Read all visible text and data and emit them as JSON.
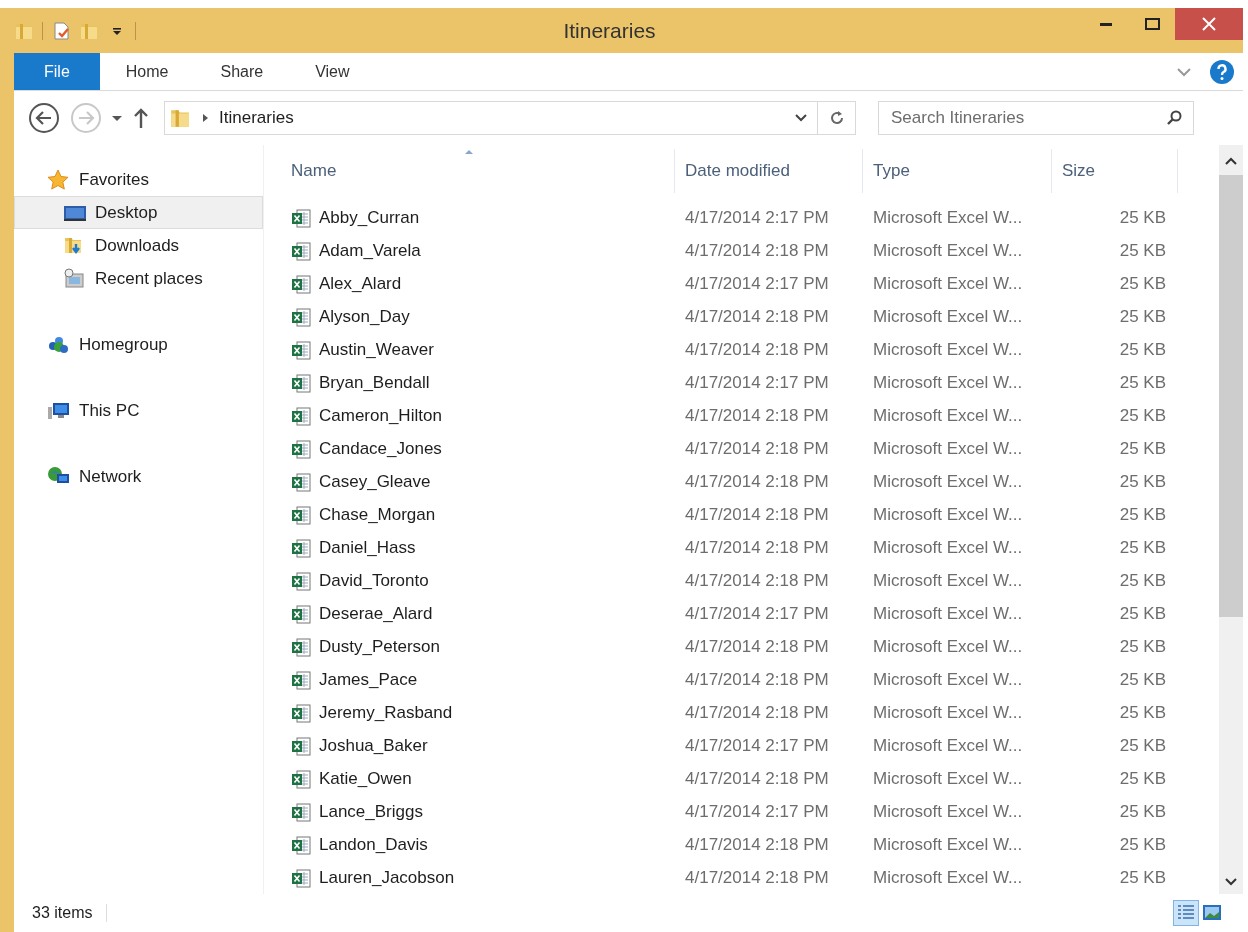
{
  "window": {
    "title": "Itineraries"
  },
  "quick_access": [
    {
      "kind": "folder"
    },
    {
      "kind": "properties"
    },
    {
      "kind": "new_folder"
    },
    {
      "kind": "customize"
    }
  ],
  "ribbon": {
    "tabs": [
      {
        "label": "File",
        "kind": "menu"
      },
      {
        "label": "Home",
        "kind": "tab"
      },
      {
        "label": "Share",
        "kind": "tab"
      },
      {
        "label": "View",
        "kind": "tab"
      }
    ]
  },
  "nav_buttons": [
    {
      "kind": "back",
      "disabled": false
    },
    {
      "kind": "forward",
      "disabled": true
    },
    {
      "kind": "recent",
      "disabled": false
    },
    {
      "kind": "up",
      "disabled": false
    }
  ],
  "address": {
    "crumbs": [
      "Itineraries"
    ]
  },
  "search": {
    "placeholder": "Search Itineraries"
  },
  "sidebar": {
    "items": [
      {
        "label": "Favorites",
        "kind": "favorites",
        "selected": false,
        "children": [
          {
            "label": "Desktop",
            "kind": "desktop",
            "selected": true
          },
          {
            "label": "Downloads",
            "kind": "downloads",
            "selected": false
          },
          {
            "label": "Recent places",
            "kind": "recent",
            "selected": false
          }
        ]
      },
      {
        "label": "Homegroup",
        "kind": "homegroup",
        "selected": false
      },
      {
        "label": "This PC",
        "kind": "pc",
        "selected": false
      },
      {
        "label": "Network",
        "kind": "network",
        "selected": false
      }
    ]
  },
  "table": {
    "columns": [
      {
        "label": "Name",
        "sorted": true
      },
      {
        "label": "Date modified",
        "sorted": false
      },
      {
        "label": "Type",
        "sorted": false
      },
      {
        "label": "Size",
        "sorted": false
      }
    ],
    "rows": [
      [
        "Abby_Curran",
        "4/17/2014 2:17 PM",
        "Microsoft Excel W...",
        "25 KB"
      ],
      [
        "Adam_Varela",
        "4/17/2014 2:18 PM",
        "Microsoft Excel W...",
        "25 KB"
      ],
      [
        "Alex_Alard",
        "4/17/2014 2:17 PM",
        "Microsoft Excel W...",
        "25 KB"
      ],
      [
        "Alyson_Day",
        "4/17/2014 2:18 PM",
        "Microsoft Excel W...",
        "25 KB"
      ],
      [
        "Austin_Weaver",
        "4/17/2014 2:18 PM",
        "Microsoft Excel W...",
        "25 KB"
      ],
      [
        "Bryan_Bendall",
        "4/17/2014 2:17 PM",
        "Microsoft Excel W...",
        "25 KB"
      ],
      [
        "Cameron_Hilton",
        "4/17/2014 2:18 PM",
        "Microsoft Excel W...",
        "25 KB"
      ],
      [
        "Candace_Jones",
        "4/17/2014 2:18 PM",
        "Microsoft Excel W...",
        "25 KB"
      ],
      [
        "Casey_Gleave",
        "4/17/2014 2:18 PM",
        "Microsoft Excel W...",
        "25 KB"
      ],
      [
        "Chase_Morgan",
        "4/17/2014 2:18 PM",
        "Microsoft Excel W...",
        "25 KB"
      ],
      [
        "Daniel_Hass",
        "4/17/2014 2:18 PM",
        "Microsoft Excel W...",
        "25 KB"
      ],
      [
        "David_Toronto",
        "4/17/2014 2:18 PM",
        "Microsoft Excel W...",
        "25 KB"
      ],
      [
        "Deserae_Alard",
        "4/17/2014 2:17 PM",
        "Microsoft Excel W...",
        "25 KB"
      ],
      [
        "Dusty_Peterson",
        "4/17/2014 2:18 PM",
        "Microsoft Excel W...",
        "25 KB"
      ],
      [
        "James_Pace",
        "4/17/2014 2:18 PM",
        "Microsoft Excel W...",
        "25 KB"
      ],
      [
        "Jeremy_Rasband",
        "4/17/2014 2:18 PM",
        "Microsoft Excel W...",
        "25 KB"
      ],
      [
        "Joshua_Baker",
        "4/17/2014 2:17 PM",
        "Microsoft Excel W...",
        "25 KB"
      ],
      [
        "Katie_Owen",
        "4/17/2014 2:18 PM",
        "Microsoft Excel W...",
        "25 KB"
      ],
      [
        "Lance_Briggs",
        "4/17/2014 2:17 PM",
        "Microsoft Excel W...",
        "25 KB"
      ],
      [
        "Landon_Davis",
        "4/17/2014 2:18 PM",
        "Microsoft Excel W...",
        "25 KB"
      ],
      [
        "Lauren_Jacobson",
        "4/17/2014 2:18 PM",
        "Microsoft Excel W...",
        "25 KB"
      ]
    ]
  },
  "status_bar": {
    "count": "33 items",
    "views": [
      {
        "kind": "details",
        "selected": true
      },
      {
        "kind": "large_icons",
        "selected": false
      }
    ]
  }
}
